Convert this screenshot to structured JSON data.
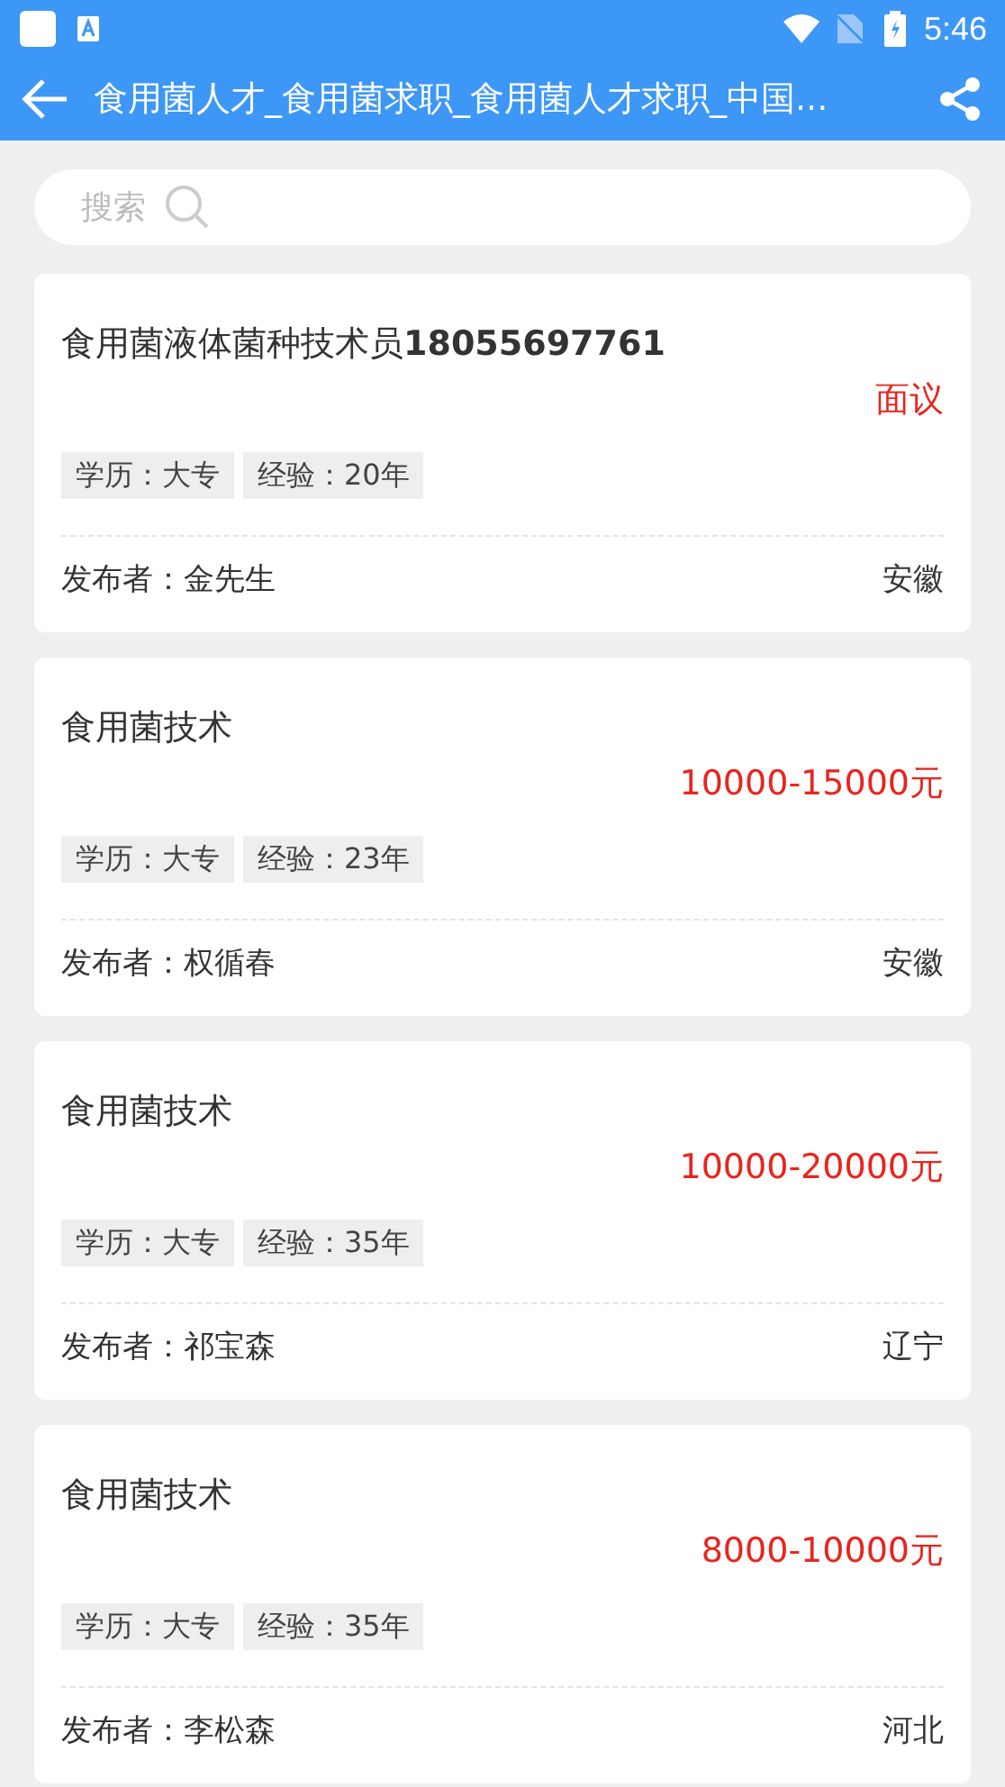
{
  "status_bar": {
    "time": "5:46"
  },
  "app_bar": {
    "title": "食用菌人才_食用菌求职_食用菌人才求职_中国..."
  },
  "search": {
    "placeholder": "搜索"
  },
  "jobs": [
    {
      "title": "食用菌液体菌种技术员**18055697761**",
      "salary": "面议",
      "tags": [
        "学历：大专",
        "经验：20年"
      ],
      "publisher": "发布者：金先生",
      "region": "安徽"
    },
    {
      "title": "食用菌技术",
      "salary": "10000-15000元",
      "tags": [
        "学历：大专",
        "经验：23年"
      ],
      "publisher": "发布者：权循春",
      "region": "安徽"
    },
    {
      "title": "食用菌技术",
      "salary": "10000-20000元",
      "tags": [
        "学历：大专",
        "经验：35年"
      ],
      "publisher": "发布者：祁宝森",
      "region": "辽宁"
    },
    {
      "title": "食用菌技术",
      "salary": "8000-10000元",
      "tags": [
        "学历：大专",
        "经验：35年"
      ],
      "publisher": "发布者：李松森",
      "region": "河北"
    }
  ]
}
